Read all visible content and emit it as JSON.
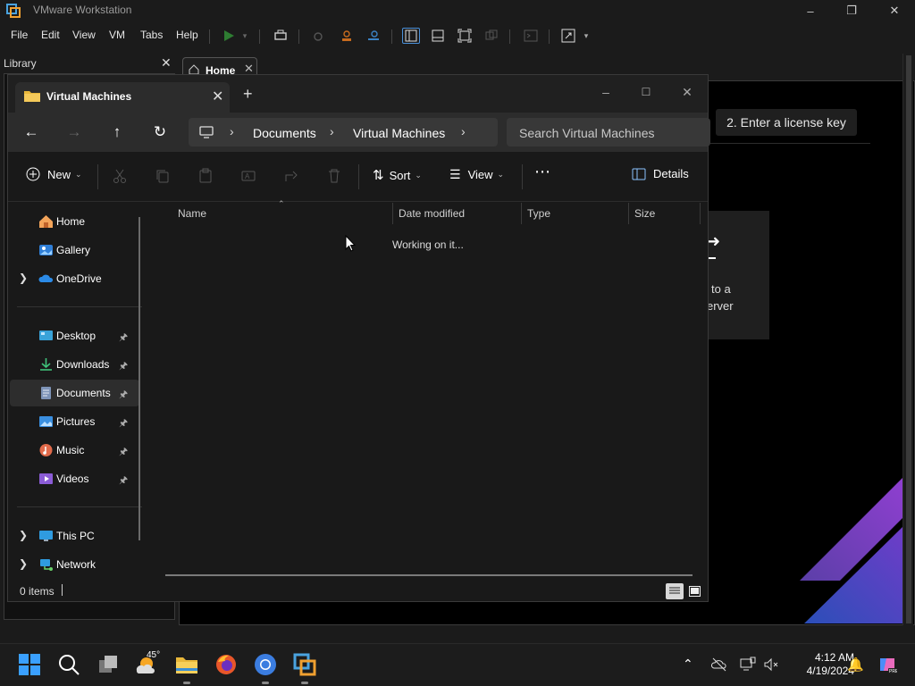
{
  "vmware": {
    "title": "VMware Workstation",
    "menu": [
      "File",
      "Edit",
      "View",
      "VM",
      "Tabs",
      "Help"
    ],
    "library_label": "Library",
    "tab_label": "Home",
    "license_button": "2. Enter a license key",
    "remote_line1": "to a",
    "remote_line2": "erver"
  },
  "explorer": {
    "tab_title": "Virtual Machines",
    "breadcrumb": [
      "Documents",
      "Virtual Machines"
    ],
    "search_placeholder": "Search Virtual Machines",
    "commands": {
      "new": "New",
      "sort": "Sort",
      "view": "View",
      "details": "Details"
    },
    "nav": {
      "home": "Home",
      "gallery": "Gallery",
      "onedrive": "OneDrive",
      "desktop": "Desktop",
      "downloads": "Downloads",
      "documents": "Documents",
      "pictures": "Pictures",
      "music": "Music",
      "videos": "Videos",
      "this_pc": "This PC",
      "network": "Network"
    },
    "columns": [
      "Name",
      "Date modified",
      "Type",
      "Size"
    ],
    "loading_text": "Working on it...",
    "status": "0 items"
  },
  "taskbar": {
    "weather_temp": "45°",
    "time": "4:12 AM",
    "date": "4/19/2024"
  },
  "colors": {
    "accent": "#0078d4",
    "folder": "#f4c23c",
    "vm_play": "#2e9e3c"
  }
}
